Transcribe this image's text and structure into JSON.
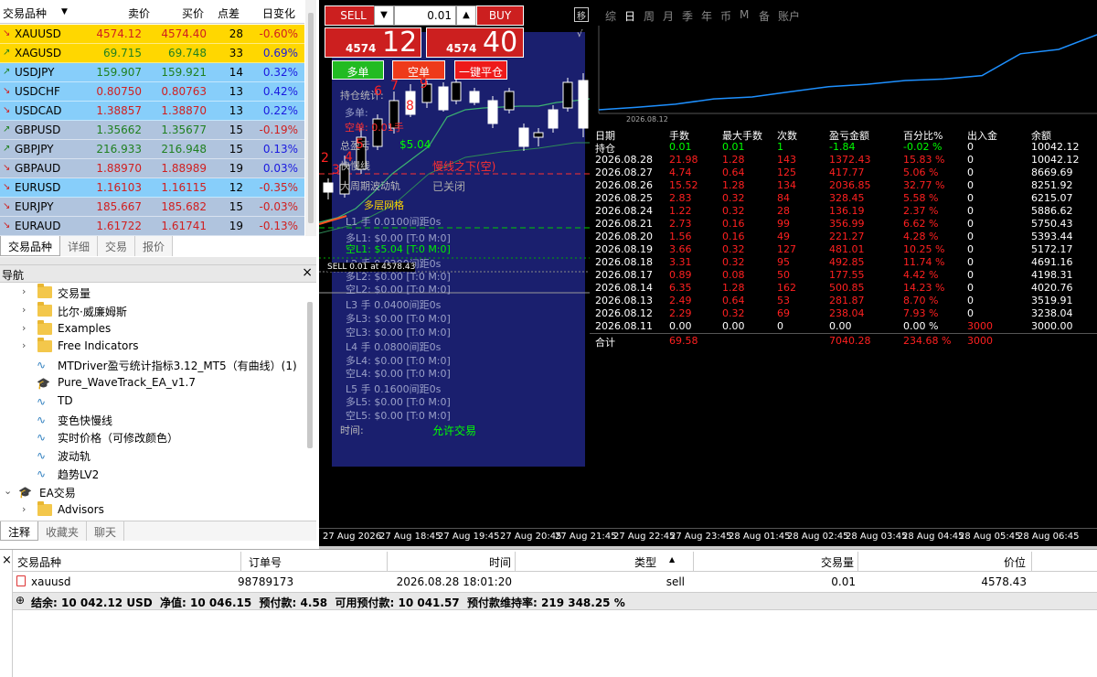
{
  "market_watch": {
    "headers": {
      "symbol": "交易品种",
      "bid": "卖价",
      "ask": "买价",
      "spread": "点差",
      "change": "日变化"
    },
    "rows": [
      {
        "symbol": "XAUUSD",
        "bid": "4574.12",
        "ask": "4574.40",
        "spread": "28",
        "change": "-0.60%",
        "dir": "down",
        "bg": "#ffd700"
      },
      {
        "symbol": "XAGUSD",
        "bid": "69.715",
        "ask": "69.748",
        "spread": "33",
        "change": "0.69%",
        "dir": "up",
        "bg": "#ffd700"
      },
      {
        "symbol": "USDJPY",
        "bid": "159.907",
        "ask": "159.921",
        "spread": "14",
        "change": "0.32%",
        "dir": "up",
        "bg": "#87cefa"
      },
      {
        "symbol": "USDCHF",
        "bid": "0.80750",
        "ask": "0.80763",
        "spread": "13",
        "change": "0.42%",
        "dir": "down",
        "bg": "#87cefa"
      },
      {
        "symbol": "USDCAD",
        "bid": "1.38857",
        "ask": "1.38870",
        "spread": "13",
        "change": "0.22%",
        "dir": "down",
        "bg": "#87cefa"
      },
      {
        "symbol": "GBPUSD",
        "bid": "1.35662",
        "ask": "1.35677",
        "spread": "15",
        "change": "-0.19%",
        "dir": "up",
        "bg": "#b0c4de"
      },
      {
        "symbol": "GBPJPY",
        "bid": "216.933",
        "ask": "216.948",
        "spread": "15",
        "change": "0.13%",
        "dir": "up",
        "bg": "#b0c4de"
      },
      {
        "symbol": "GBPAUD",
        "bid": "1.88970",
        "ask": "1.88989",
        "spread": "19",
        "change": "0.03%",
        "dir": "down",
        "bg": "#b0c4de"
      },
      {
        "symbol": "EURUSD",
        "bid": "1.16103",
        "ask": "1.16115",
        "spread": "12",
        "change": "-0.35%",
        "dir": "down",
        "bg": "#87cefa"
      },
      {
        "symbol": "EURJPY",
        "bid": "185.667",
        "ask": "185.682",
        "spread": "15",
        "change": "-0.03%",
        "dir": "down",
        "bg": "#b0c4de"
      },
      {
        "symbol": "EURAUD",
        "bid": "1.61722",
        "ask": "1.61741",
        "spread": "19",
        "change": "-0.13%",
        "dir": "down",
        "bg": "#b0c4de"
      }
    ],
    "tabs": [
      "交易品种",
      "详细",
      "交易",
      "报价"
    ]
  },
  "navigator": {
    "title": "导航",
    "items": [
      {
        "label": "交易量",
        "type": "folder",
        "indent": 1
      },
      {
        "label": "比尔·威廉姆斯",
        "type": "folder",
        "indent": 1
      },
      {
        "label": "Examples",
        "type": "folder",
        "indent": 1
      },
      {
        "label": "Free Indicators",
        "type": "folder",
        "indent": 1
      },
      {
        "label": "MTDriver盈亏统计指标3.12_MT5（有曲线）(1)",
        "type": "indicator",
        "indent": 1
      },
      {
        "label": "Pure_WaveTrack_EA_v1.7",
        "type": "ea",
        "indent": 1
      },
      {
        "label": "TD",
        "type": "indicator",
        "indent": 1
      },
      {
        "label": "变色快慢线",
        "type": "indicator",
        "indent": 1
      },
      {
        "label": "实时价格（可修改颜色）",
        "type": "indicator",
        "indent": 1
      },
      {
        "label": "波动轨",
        "type": "indicator",
        "indent": 1
      },
      {
        "label": "趋势LV2",
        "type": "indicator",
        "indent": 1
      },
      {
        "label": "EA交易",
        "type": "ea-root",
        "indent": 0
      },
      {
        "label": "Advisors",
        "type": "folder",
        "indent": 1
      }
    ],
    "tabs": [
      "注释",
      "收藏夹",
      "聊天"
    ]
  },
  "trade_panel": {
    "sell_label": "SELL",
    "buy_label": "BUY",
    "lot": "0.01",
    "sell_price_small": "4574",
    "sell_price_big": "12",
    "buy_price_small": "4574",
    "buy_price_big": "40",
    "long_btn": "多单",
    "short_btn": "空单",
    "close_all_btn": "一键平仓"
  },
  "ea_panel": {
    "lines": [
      "持仓统计:",
      "多单:",
      "空单: 0.01手",
      "总盈亏",
      "快慢线",
      "大周期波动轨",
      "多层网格",
      "L1 手 0.0100间距0s",
      "多L1: $0.00 [T:0 M:0]",
      "空L1: $5.04 [T:0 M:0]",
      "L2 手 0.0200间距0s",
      "多L2: $0.00 [T:0 M:0]",
      "空L2: $0.00 [T:0 M:0]",
      "L3 手 0.0400间距0s",
      "多L3: $0.00 [T:0 M:0]",
      "空L3: $0.00 [T:0 M:0]",
      "L4 手 0.0800间距0s",
      "多L4: $0.00 [T:0 M:0]",
      "空L4: $0.00 [T:0 M:0]",
      "L5 手 0.1600间距0s",
      "多L5: $0.00 [T:0 M:0]",
      "空L5: $0.00 [T:0 M:0]",
      "时间:"
    ],
    "total_pl": "$5.04",
    "ma_status": "慢线之下(空)",
    "band_status": "已关闭",
    "trade_status": "允许交易",
    "sell_line": "SELL 0.01 at 4578.43",
    "numbers": [
      "2",
      "3",
      "4",
      "5",
      "6",
      "7",
      "8",
      "9"
    ]
  },
  "summary": {
    "period_tabs": [
      "综",
      "日",
      "周",
      "月",
      "季",
      "年",
      "币",
      "M",
      "备",
      "账户"
    ],
    "chart_date": "2026.08.12",
    "headers": [
      "日期",
      "手数",
      "最大手数",
      "次数",
      "盈亏金额",
      "百分比%",
      "出入金",
      "余额"
    ],
    "position_row": [
      "持仓",
      "0.01",
      "0.01",
      "1",
      "-1.84",
      "-0.02 %",
      "0",
      "10042.12"
    ],
    "rows": [
      [
        "2026.08.28",
        "21.98",
        "1.28",
        "143",
        "1372.43",
        "15.83 %",
        "0",
        "10042.12"
      ],
      [
        "2026.08.27",
        "4.74",
        "0.64",
        "125",
        "417.77",
        "5.06 %",
        "0",
        "8669.69"
      ],
      [
        "2026.08.26",
        "15.52",
        "1.28",
        "134",
        "2036.85",
        "32.77 %",
        "0",
        "8251.92"
      ],
      [
        "2026.08.25",
        "2.83",
        "0.32",
        "84",
        "328.45",
        "5.58 %",
        "0",
        "6215.07"
      ],
      [
        "2026.08.24",
        "1.22",
        "0.32",
        "28",
        "136.19",
        "2.37 %",
        "0",
        "5886.62"
      ],
      [
        "2026.08.21",
        "2.73",
        "0.16",
        "99",
        "356.99",
        "6.62 %",
        "0",
        "5750.43"
      ],
      [
        "2026.08.20",
        "1.56",
        "0.16",
        "49",
        "221.27",
        "4.28 %",
        "0",
        "5393.44"
      ],
      [
        "2026.08.19",
        "3.66",
        "0.32",
        "127",
        "481.01",
        "10.25 %",
        "0",
        "5172.17"
      ],
      [
        "2026.08.18",
        "3.31",
        "0.32",
        "95",
        "492.85",
        "11.74 %",
        "0",
        "4691.16"
      ],
      [
        "2026.08.17",
        "0.89",
        "0.08",
        "50",
        "177.55",
        "4.42 %",
        "0",
        "4198.31"
      ],
      [
        "2026.08.14",
        "6.35",
        "1.28",
        "162",
        "500.85",
        "14.23 %",
        "0",
        "4020.76"
      ],
      [
        "2026.08.13",
        "2.49",
        "0.64",
        "53",
        "281.87",
        "8.70 %",
        "0",
        "3519.91"
      ],
      [
        "2026.08.12",
        "2.29",
        "0.32",
        "69",
        "238.04",
        "7.93 %",
        "0",
        "3238.04"
      ],
      [
        "2026.08.11",
        "0.00",
        "0.00",
        "0",
        "0.00",
        "0.00 %",
        "3000",
        "3000.00"
      ]
    ],
    "total_row": [
      "合计",
      "69.58",
      "",
      "",
      "7040.28",
      "234.68 %",
      "3000",
      ""
    ]
  },
  "x_axis": [
    "27 Aug 2026",
    "27 Aug 18:45",
    "27 Aug 19:45",
    "27 Aug 20:45",
    "27 Aug 21:45",
    "27 Aug 22:45",
    "27 Aug 23:45",
    "28 Aug 01:45",
    "28 Aug 02:45",
    "28 Aug 03:45",
    "28 Aug 04:45",
    "28 Aug 05:45",
    "28 Aug 06:45"
  ],
  "terminal": {
    "headers": [
      "交易品种",
      "订单号",
      "时间",
      "类型",
      "交易量",
      "价位"
    ],
    "row": {
      "symbol": "xauusd",
      "ticket": "98789173",
      "time": "2026.08.28 18:01:20",
      "type": "sell",
      "volume": "0.01",
      "price": "4578.43"
    },
    "balance_line": "结余: 10 042.12 USD  净值: 10 046.15  预付款: 4.58  可用预付款: 10 041.57  预付款维持率: 219 348.25 %"
  }
}
